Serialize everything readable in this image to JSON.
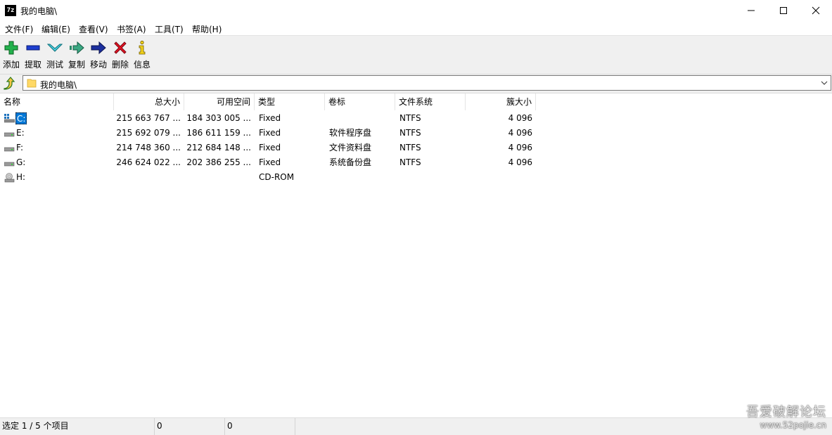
{
  "window": {
    "title": "我的电脑\\",
    "app_icon_text": "7z",
    "minimize_icon": "minimize-icon",
    "maximize_icon": "maximize-icon",
    "close_icon": "close-icon"
  },
  "menu": [
    "文件(F)",
    "编辑(E)",
    "查看(V)",
    "书签(A)",
    "工具(T)",
    "帮助(H)"
  ],
  "toolbar": {
    "add": "添加",
    "extract": "提取",
    "test": "测试",
    "copy": "复制",
    "move": "移动",
    "delete": "删除",
    "info": "信息"
  },
  "address": {
    "path": "我的电脑\\"
  },
  "columns": {
    "name": "名称",
    "total": "总大小",
    "free": "可用空间",
    "type": "类型",
    "label": "卷标",
    "fs": "文件系统",
    "cluster": "簇大小"
  },
  "rows": [
    {
      "name": "C:",
      "total": "215 663 767 ...",
      "free": "184 303 005 ...",
      "type": "Fixed",
      "label": "",
      "fs": "NTFS",
      "cluster": "4 096",
      "icon": "system-drive-icon"
    },
    {
      "name": "E:",
      "total": "215 692 079 ...",
      "free": "186 611 159 ...",
      "type": "Fixed",
      "label": "软件程序盘",
      "fs": "NTFS",
      "cluster": "4 096",
      "icon": "hard-drive-icon"
    },
    {
      "name": "F:",
      "total": "214 748 360 ...",
      "free": "212 684 148 ...",
      "type": "Fixed",
      "label": "文件资料盘",
      "fs": "NTFS",
      "cluster": "4 096",
      "icon": "hard-drive-icon"
    },
    {
      "name": "G:",
      "total": "246 624 022 ...",
      "free": "202 386 255 ...",
      "type": "Fixed",
      "label": "系统备份盘",
      "fs": "NTFS",
      "cluster": "4 096",
      "icon": "hard-drive-icon"
    },
    {
      "name": "H:",
      "total": "",
      "free": "",
      "type": "CD-ROM",
      "label": "",
      "fs": "",
      "cluster": "",
      "icon": "cd-drive-icon"
    }
  ],
  "status": {
    "selection": "选定 1 / 5 个项目",
    "size": "0",
    "packed": "0"
  },
  "watermark": {
    "title": "吾爱破解论坛",
    "url": "www.52pojie.cn"
  },
  "colors": {
    "selection": "#0078d7",
    "add_green": "#22b14c",
    "delete_red": "#e81123",
    "toolbar_bg": "#f0f0f0"
  }
}
